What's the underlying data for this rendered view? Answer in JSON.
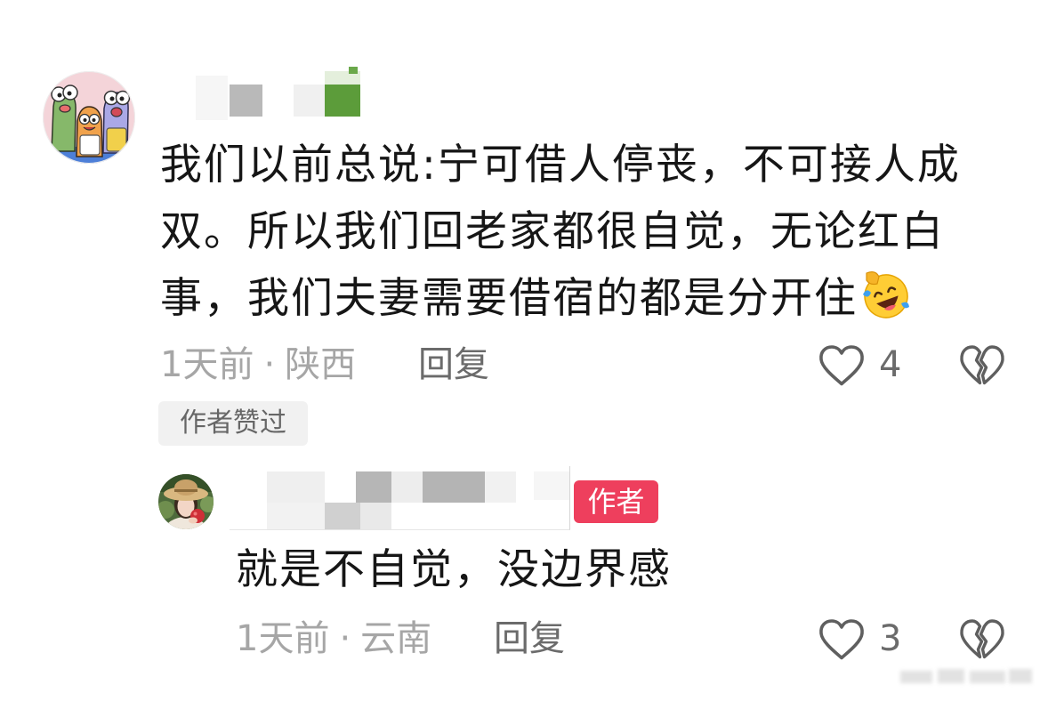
{
  "comment": {
    "text_lines": [
      "我们以前总说:宁可借人停丧，不可接人成",
      "双。所以我们回老家都很自觉，无论红白",
      "事，我们夫妻需要借宿的都是分开住"
    ],
    "time": "1天前",
    "location": "陕西",
    "reply_label": "回复",
    "like_count": "4",
    "author_liked_badge": "作者赞过"
  },
  "reply": {
    "author_badge": "作者",
    "text": "就是不自觉，没边界感",
    "time": "1天前",
    "location": "云南",
    "reply_label": "回复",
    "like_count": "3"
  },
  "meta_separator": "·",
  "icons": {
    "commenter_avatar": "cartoon-characters-avatar",
    "reply_avatar": "woman-straw-hat-photo-avatar",
    "emoji": "laughing-tears-emoji-icon",
    "like": "heart-outline-icon",
    "dislike": "broken-heart-icon"
  },
  "colors": {
    "text": "#161616",
    "meta": "#a6a6a6",
    "action": "#6b6b6b",
    "icon": "#5f5f5f",
    "author_badge": "#ee3f5d",
    "badge_bg": "#f1f1f1",
    "badge_text": "#666666"
  }
}
